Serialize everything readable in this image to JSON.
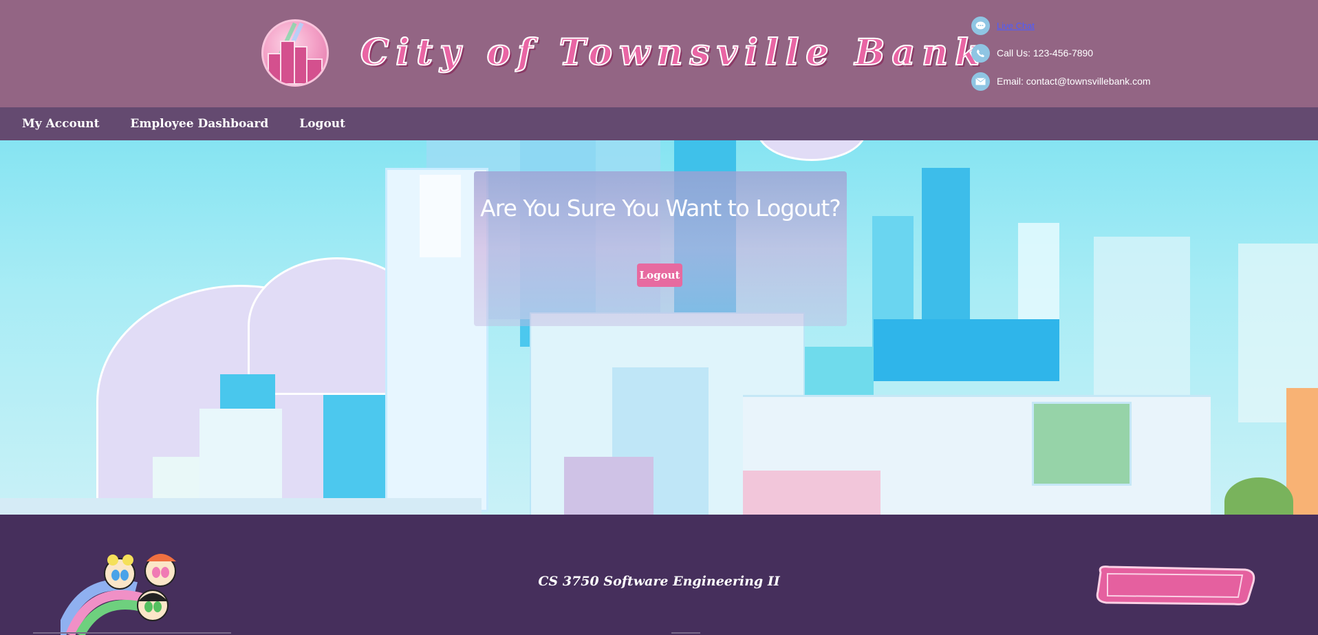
{
  "header": {
    "bank_name": "City of Townsville Bank",
    "contacts": {
      "chat_label": "Live Chat",
      "phone": "Call Us: 123-456-7890",
      "email": "Email: contact@townsvillebank.com"
    }
  },
  "nav": {
    "items": [
      "My Account",
      "Employee Dashboard",
      "Logout"
    ]
  },
  "modal": {
    "heading": "Are You Sure You Want to Logout?",
    "button_label": "Logout"
  },
  "footer": {
    "course": "CS 3750 Software Engineering II",
    "brand_logo": "The Powerpuff Girls"
  },
  "colors": {
    "header_bg": "#936584",
    "nav_bg": "#644a70",
    "footer_bg": "#462f5c",
    "accent_pink": "#e76aa0",
    "icon_blue": "#8fc5e3",
    "sky": "#86e4f2"
  },
  "icons": [
    "chat-bubble-icon",
    "phone-icon",
    "mail-icon"
  ]
}
